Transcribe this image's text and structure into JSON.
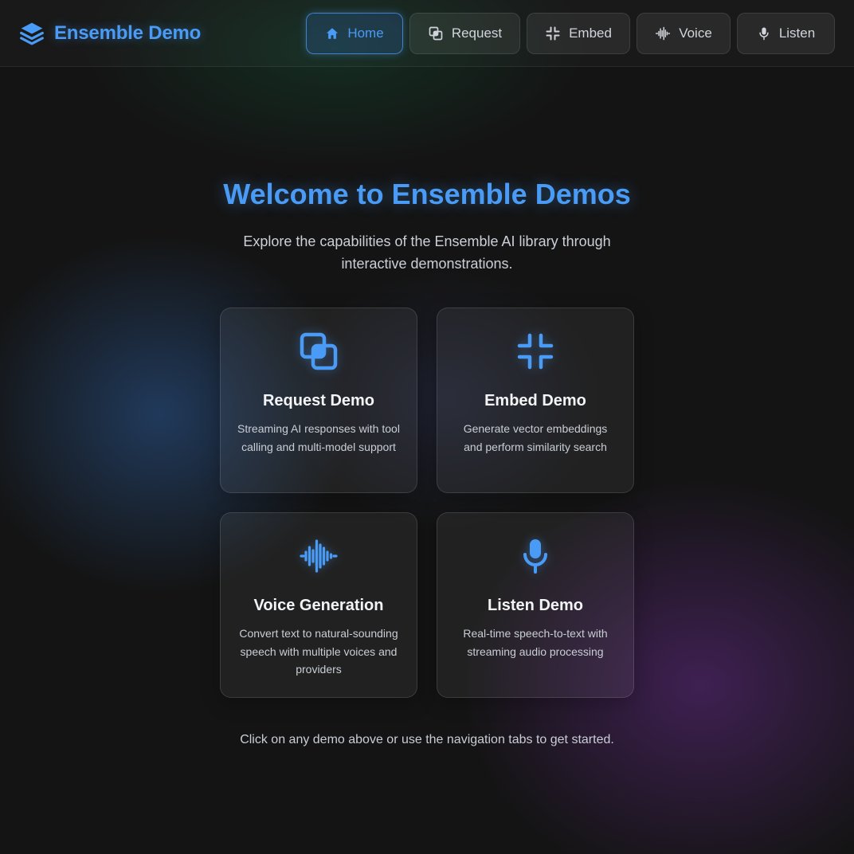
{
  "app": {
    "title": "Ensemble Demo",
    "brand_icon": "layers-icon",
    "accent_color": "#4a9bf5"
  },
  "nav": {
    "tabs": [
      {
        "label": "Home",
        "icon": "home-icon",
        "active": true
      },
      {
        "label": "Request",
        "icon": "copy-squares-icon",
        "active": false
      },
      {
        "label": "Embed",
        "icon": "minimize-corners-icon",
        "active": false
      },
      {
        "label": "Voice",
        "icon": "audio-waveform-icon",
        "active": false
      },
      {
        "label": "Listen",
        "icon": "microphone-icon",
        "active": false
      }
    ]
  },
  "hero": {
    "title": "Welcome to Ensemble Demos",
    "subtitle": "Explore the capabilities of the Ensemble AI library through interactive demonstrations."
  },
  "cards": [
    {
      "title": "Request Demo",
      "description": "Streaming AI responses with tool calling and multi-model support",
      "icon": "copy-squares-icon"
    },
    {
      "title": "Embed Demo",
      "description": "Generate vector embeddings and perform similarity search",
      "icon": "minimize-corners-icon"
    },
    {
      "title": "Voice Generation",
      "description": "Convert text to natural-sounding speech with multiple voices and providers",
      "icon": "audio-waveform-icon"
    },
    {
      "title": "Listen Demo",
      "description": "Real-time speech-to-text with streaming audio processing",
      "icon": "microphone-icon"
    }
  ],
  "footer": {
    "hint": "Click on any demo above or use the navigation tabs to get started."
  }
}
